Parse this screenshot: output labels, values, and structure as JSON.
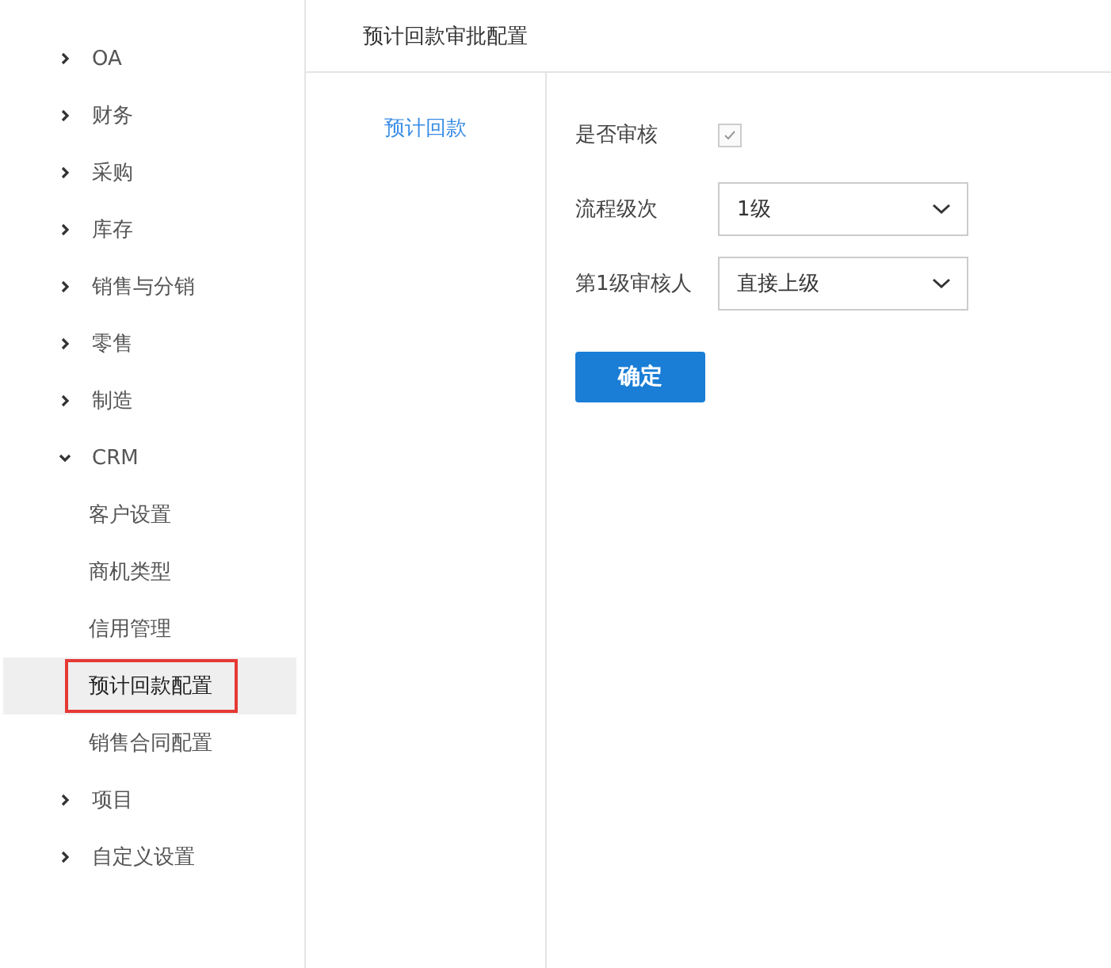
{
  "sidebar": {
    "items": [
      {
        "label": "OA",
        "expanded": false
      },
      {
        "label": "财务",
        "expanded": false
      },
      {
        "label": "采购",
        "expanded": false
      },
      {
        "label": "库存",
        "expanded": false
      },
      {
        "label": "销售与分销",
        "expanded": false
      },
      {
        "label": "零售",
        "expanded": false
      },
      {
        "label": "制造",
        "expanded": false
      },
      {
        "label": "CRM",
        "expanded": true,
        "children": [
          {
            "label": "客户设置",
            "selected": false
          },
          {
            "label": "商机类型",
            "selected": false
          },
          {
            "label": "信用管理",
            "selected": false
          },
          {
            "label": "预计回款配置",
            "selected": true
          },
          {
            "label": "销售合同配置",
            "selected": false
          }
        ]
      },
      {
        "label": "项目",
        "expanded": false
      },
      {
        "label": "自定义设置",
        "expanded": false
      }
    ]
  },
  "header": {
    "title": "预计回款审批配置"
  },
  "tabs": [
    {
      "label": "预计回款",
      "selected": true
    }
  ],
  "form": {
    "fields": [
      {
        "kind": "checkbox",
        "label": "是否审核",
        "checked": true
      },
      {
        "kind": "select",
        "label": "流程级次",
        "value": "1级"
      },
      {
        "kind": "select",
        "label": "第1级审核人",
        "value": "直接上级"
      }
    ],
    "submit": "确定"
  }
}
